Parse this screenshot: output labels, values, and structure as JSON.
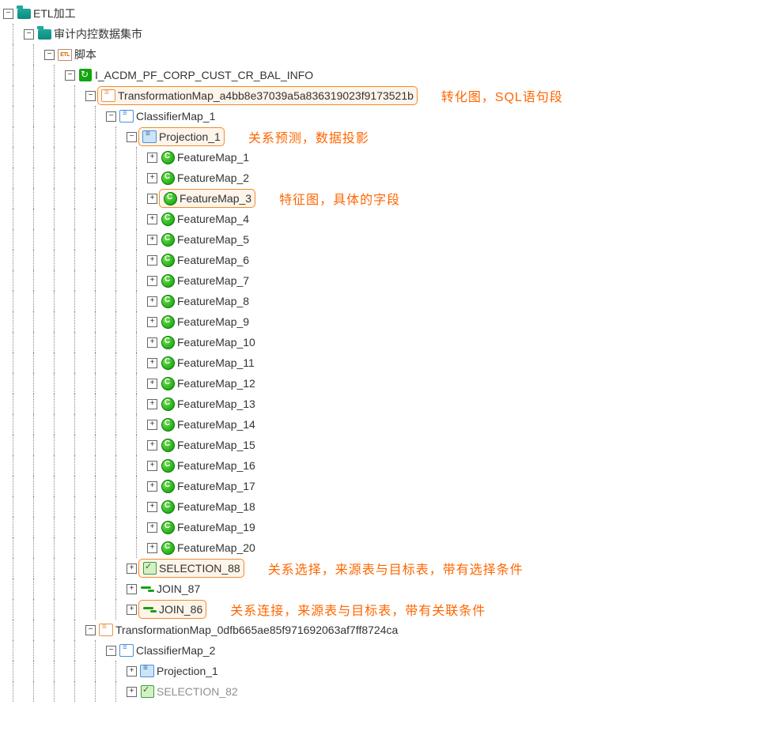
{
  "tree": {
    "root": "ETL加工",
    "datamart": "审计内控数据集市",
    "scripts": "脚本",
    "etl_label": "ETL",
    "job": "I_ACDM_PF_CORP_CUST_CR_BAL_INFO",
    "tmap1": "TransformationMap_a4bb8e37039a5a836319023f9173521b",
    "cmap1": "ClassifierMap_1",
    "proj1": "Projection_1",
    "features": [
      "FeatureMap_1",
      "FeatureMap_2",
      "FeatureMap_3",
      "FeatureMap_4",
      "FeatureMap_5",
      "FeatureMap_6",
      "FeatureMap_7",
      "FeatureMap_8",
      "FeatureMap_9",
      "FeatureMap_10",
      "FeatureMap_11",
      "FeatureMap_12",
      "FeatureMap_13",
      "FeatureMap_14",
      "FeatureMap_15",
      "FeatureMap_16",
      "FeatureMap_17",
      "FeatureMap_18",
      "FeatureMap_19",
      "FeatureMap_20"
    ],
    "selection88": "SELECTION_88",
    "join87": "JOIN_87",
    "join86": "JOIN_86",
    "tmap2": "TransformationMap_0dfb665ae85f971692063af7ff8724ca",
    "cmap2": "ClassifierMap_2",
    "proj2": "Projection_1",
    "selection82": "SELECTION_82"
  },
  "toggles": {
    "minus": "−",
    "plus": "+"
  },
  "annotations": {
    "tmap": "转化图，SQL语句段",
    "proj": "关系预测，数据投影",
    "feat": "特征图，具体的字段",
    "sel": "关系选择，来源表与目标表，带有选择条件",
    "join": "关系连接，来源表与目标表，带有关联条件"
  }
}
